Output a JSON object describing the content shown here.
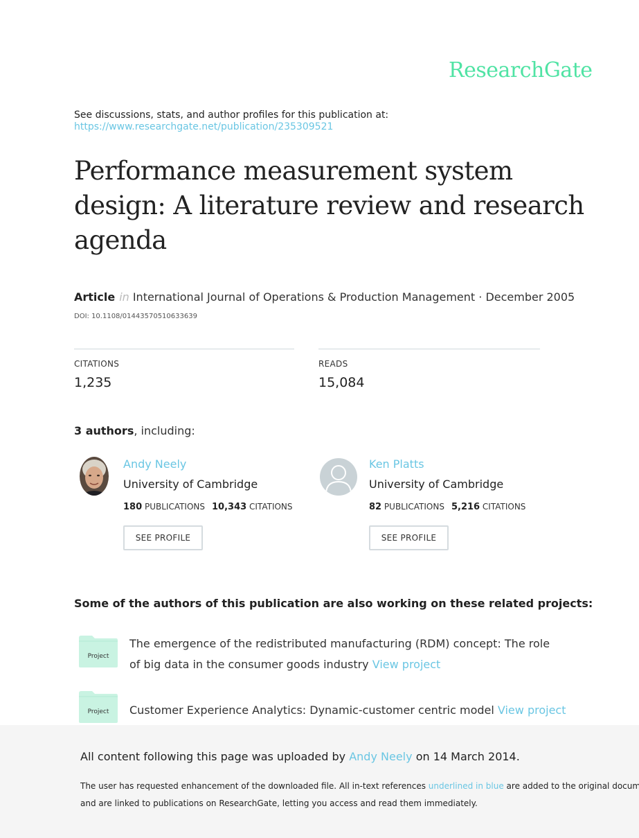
{
  "brand": {
    "name": "ResearchGate",
    "color": "#50e3a4"
  },
  "header": {
    "see_discussions": "See discussions, stats, and author profiles for this publication at:",
    "url": "https://www.researchgate.net/publication/235309521"
  },
  "publication": {
    "title": "Performance measurement system design: A literature review and research agenda",
    "type": "Article",
    "in_word": "in",
    "journal_date": "International Journal of Operations & Production Management · December 2005",
    "doi": "DOI: 10.1108/01443570510633639"
  },
  "stats": {
    "citations_label": "CITATIONS",
    "citations_value": "1,235",
    "reads_label": "READS",
    "reads_value": "15,084"
  },
  "authors": {
    "count_bold": "3 authors",
    "count_rest": ", including:",
    "list": [
      {
        "name": "Andy Neely",
        "institution": "University of Cambridge",
        "publications": "180",
        "publications_label": "PUBLICATIONS",
        "citations": "10,343",
        "citations_label": "CITATIONS",
        "button": "SEE PROFILE",
        "avatar": "photo-avatar"
      },
      {
        "name": "Ken Platts",
        "institution": "University of Cambridge",
        "publications": "82",
        "publications_label": "PUBLICATIONS",
        "citations": "5,216",
        "citations_label": "CITATIONS",
        "button": "SEE PROFILE",
        "avatar": "default-person-icon"
      }
    ]
  },
  "related": {
    "heading": "Some of the authors of this publication are also working on these related projects:",
    "folder_label": "Project",
    "projects": [
      {
        "text": "The emergence of the redistributed manufacturing (RDM) concept: The role of big data in the consumer goods industry",
        "link": "View project"
      },
      {
        "text": "Customer Experience Analytics: Dynamic-customer centric model",
        "link": "View project"
      }
    ]
  },
  "footer": {
    "uploaded_pre": "All content following this page was uploaded by",
    "uploaded_name": "Andy Neely",
    "uploaded_post": "on 14 March 2014.",
    "note_pre": "The user has requested enhancement of the downloaded file. All in-text references",
    "note_link": "underlined in blue",
    "note_post": "are added to the original document",
    "note_line2": "and are linked to publications on ResearchGate, letting you access and read them immediately."
  },
  "colors": {
    "link": "#6ac6e3",
    "folder": "#c9f3e2",
    "footer_bg": "#f5f5f5"
  }
}
